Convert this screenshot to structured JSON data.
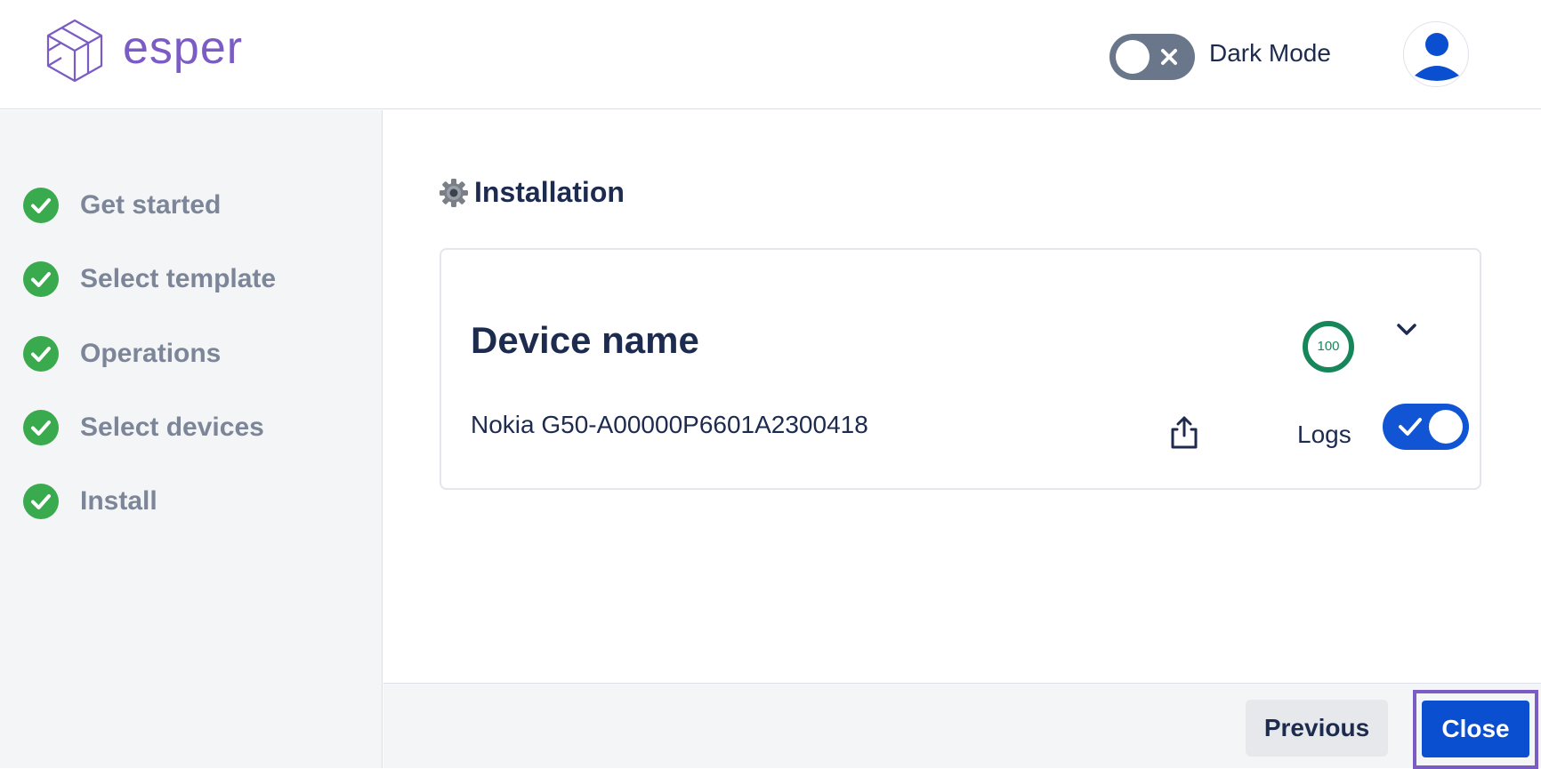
{
  "header": {
    "logo_text": "esper",
    "dark_mode_label": "Dark Mode"
  },
  "sidebar": {
    "steps": [
      {
        "label": "Get started",
        "status": "complete"
      },
      {
        "label": "Select template",
        "status": "complete"
      },
      {
        "label": "Operations",
        "status": "complete"
      },
      {
        "label": "Select devices",
        "status": "complete"
      },
      {
        "label": "Install",
        "status": "complete"
      }
    ]
  },
  "main": {
    "section_title": "Installation",
    "card": {
      "title": "Device name",
      "progress": "100",
      "device_id": "Nokia G50-A00000P6601A2300418",
      "logs_label": "Logs",
      "logs_enabled": true
    }
  },
  "footer": {
    "previous_label": "Previous",
    "close_label": "Close"
  },
  "colors": {
    "brand": "#7b5cc4",
    "primary": "#0b4fd1",
    "success": "#3aaa4e",
    "progress": "#17865b"
  }
}
